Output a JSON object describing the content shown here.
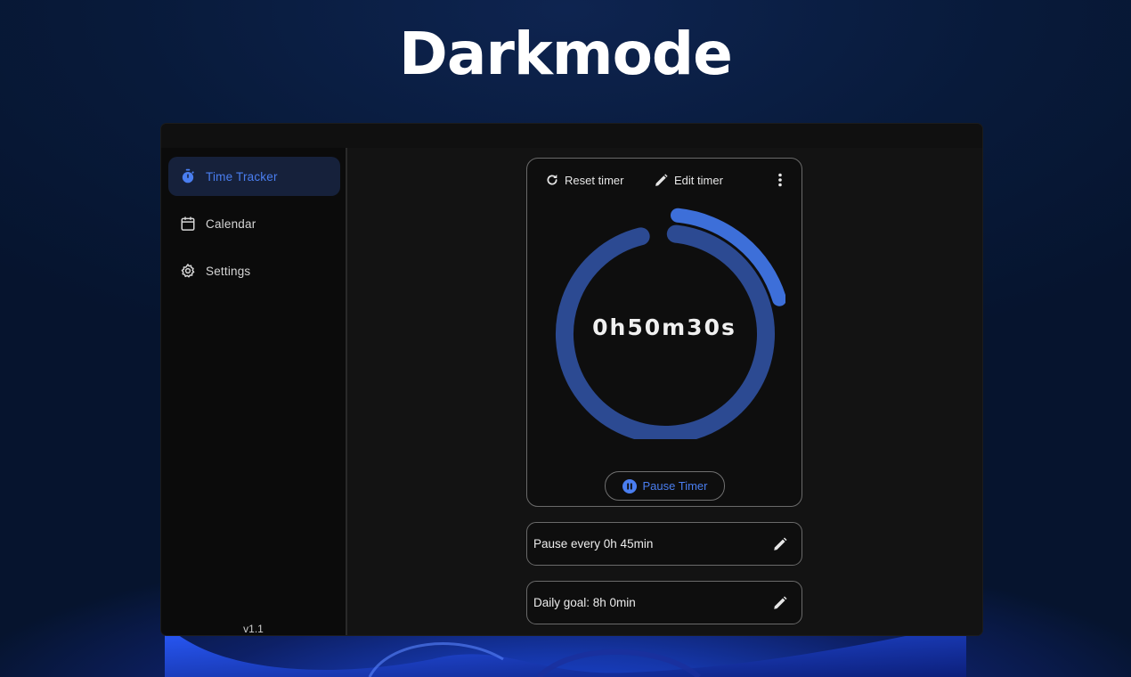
{
  "hero": {
    "title": "Darkmode"
  },
  "sidebar": {
    "items": [
      {
        "label": "Time Tracker",
        "icon": "stopwatch-icon",
        "active": true
      },
      {
        "label": "Calendar",
        "icon": "calendar-icon",
        "active": false
      },
      {
        "label": "Settings",
        "icon": "gear-icon",
        "active": false
      }
    ],
    "version": "v1.1"
  },
  "timer": {
    "reset_label": "Reset timer",
    "edit_label": "Edit timer",
    "time": "0h50m30s",
    "pause_label": "Pause Timer",
    "progress_fraction": 1.12
  },
  "settings": {
    "pause_text": "Pause every 0h 45min",
    "goal_text": "Daily goal: 8h 0min"
  },
  "colors": {
    "accent": "#4a7ef0",
    "ring": "#2c4a92",
    "ring_overflow": "#3d6fd9",
    "sidebar_active_bg": "#16213b"
  }
}
